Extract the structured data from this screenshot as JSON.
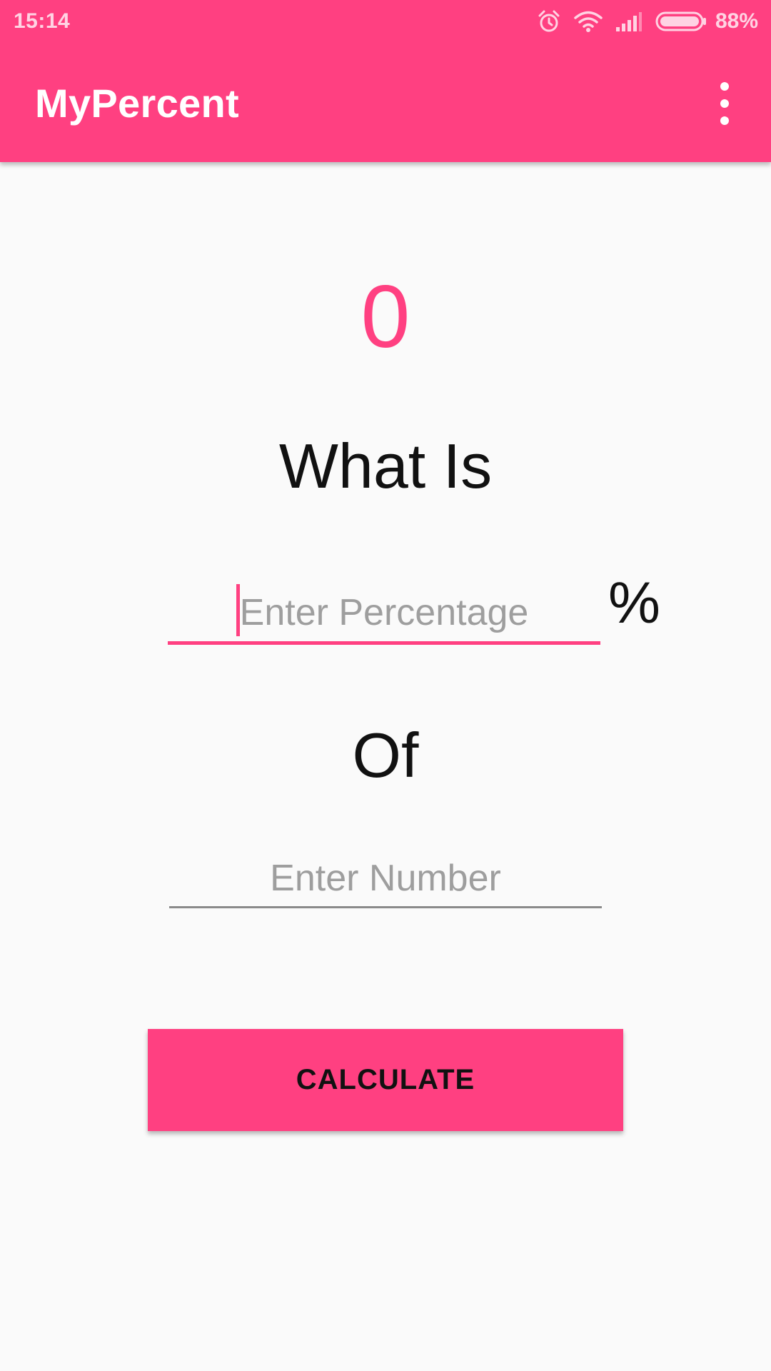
{
  "status_bar": {
    "time": "15:14",
    "battery_percent": "88%",
    "icons": [
      "alarm-icon",
      "wifi-icon",
      "signal-icon",
      "battery-icon"
    ]
  },
  "app_bar": {
    "title": "MyPercent",
    "menu_icon": "more-vert-icon"
  },
  "main": {
    "result": "0",
    "what_is_label": "What Is",
    "percentage_input": {
      "value": "",
      "placeholder": "Enter Percentage"
    },
    "percent_sign": "%",
    "of_label": "Of",
    "number_input": {
      "value": "",
      "placeholder": "Enter Number"
    },
    "calculate_label": "CALCULATE"
  },
  "colors": {
    "accent": "#ff4081",
    "background": "#fafafa",
    "placeholder": "#9e9e9e"
  }
}
